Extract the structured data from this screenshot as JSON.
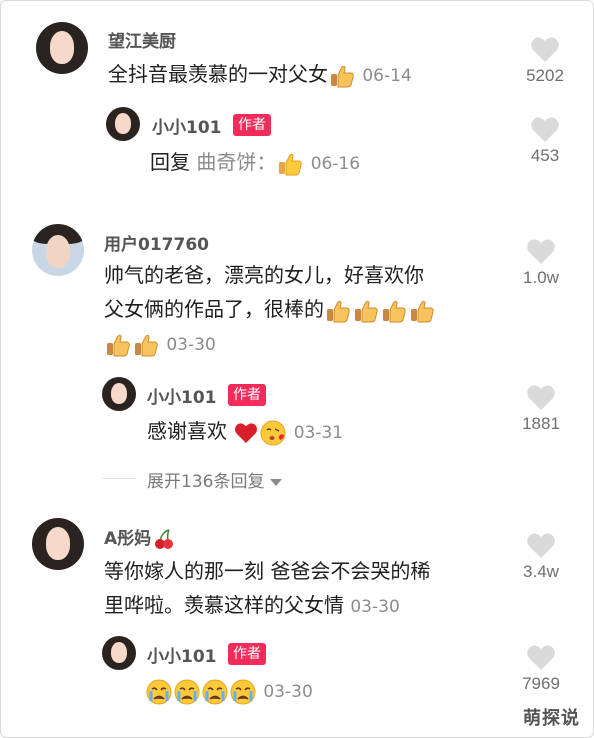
{
  "comments": [
    {
      "user": "望江美厨",
      "text": "全抖音最羡慕的一对父女",
      "date": "06-14",
      "likes": "5202",
      "reply": {
        "user": "小小101",
        "badge": "作者",
        "prefix": "回复",
        "quoted": "曲奇饼：",
        "date": "06-16",
        "likes": "453"
      }
    },
    {
      "user": "用户017760",
      "text_line1": "帅气的老爸，漂亮的女儿，好喜欢你",
      "text_line2": "父女俩的作品了，很棒的",
      "date": "03-30",
      "likes": "1.0w",
      "reply": {
        "user": "小小101",
        "badge": "作者",
        "text": "感谢喜欢",
        "date": "03-31",
        "likes": "1881"
      },
      "expand": "展开136条回复"
    },
    {
      "user": "A彤妈",
      "text_line1": "等你嫁人的那一刻 爸爸会不会哭的稀",
      "text_line2": "里哗啦。羡慕这样的父女情",
      "date": "03-30",
      "likes": "3.4w",
      "reply": {
        "user": "小小101",
        "badge": "作者",
        "date": "03-30",
        "likes": "7969"
      }
    }
  ],
  "watermark": "萌探说",
  "colors": {
    "accent": "#f12b5a",
    "muted": "#8c8c8c",
    "heart": "#d9d9d9"
  },
  "icons": [
    "thumbs-up-icon",
    "heart-icon",
    "kiss-icon",
    "crying-icon",
    "cherry-icon",
    "caret-down-icon"
  ]
}
